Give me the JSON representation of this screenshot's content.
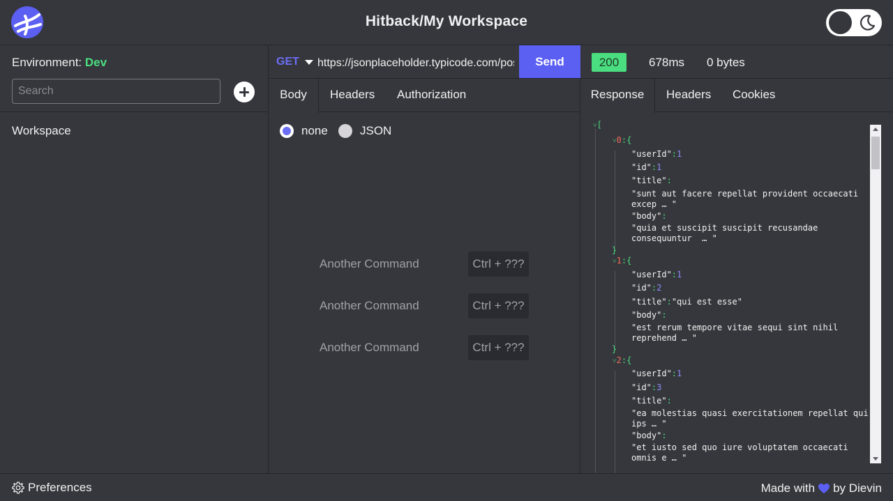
{
  "header": {
    "title": "Hitback/My Workspace",
    "logo_icon": "globe-logo",
    "theme_toggle_icon": "moon-icon"
  },
  "sidebar": {
    "environment_label": "Environment:",
    "environment_value": "Dev",
    "search_placeholder": "Search",
    "add_icon": "plus-circle-icon",
    "items": [
      {
        "label": "Workspace"
      }
    ]
  },
  "request": {
    "method": "GET",
    "url": "https://jsonplaceholder.typicode.com/posts",
    "send_label": "Send",
    "tabs": [
      {
        "label": "Body",
        "active": true
      },
      {
        "label": "Headers",
        "active": false
      },
      {
        "label": "Authorization",
        "active": false
      }
    ],
    "body_types": [
      {
        "label": "none",
        "selected": true
      },
      {
        "label": "JSON",
        "selected": false
      }
    ],
    "commands": [
      {
        "label": "Another Command",
        "shortcut": "Ctrl + ???"
      },
      {
        "label": "Another Command",
        "shortcut": "Ctrl + ???"
      },
      {
        "label": "Another Command",
        "shortcut": "Ctrl + ???"
      }
    ]
  },
  "response": {
    "status": "200",
    "time": "678ms",
    "size": "0 bytes",
    "tabs": [
      {
        "label": "Response",
        "active": true
      },
      {
        "label": "Headers",
        "active": false
      },
      {
        "label": "Cookies",
        "active": false
      }
    ],
    "json": {
      "open_bracket": "[",
      "items": [
        {
          "index": "0",
          "userId_key": "\"userId\"",
          "userId": "1",
          "id_key": "\"id\"",
          "id": "1",
          "title_key": "\"title\"",
          "title_line1": "\"sunt aut facere repellat provident occaecati",
          "title_line2": "excep … \"",
          "body_key": "\"body\"",
          "body_line1": "\"quia et suscipit suscipit recusandae",
          "body_line2": "consequuntur  … \""
        },
        {
          "index": "1",
          "userId_key": "\"userId\"",
          "userId": "1",
          "id_key": "\"id\"",
          "id": "2",
          "title_key": "\"title\"",
          "title_inline": "\"qui est esse\"",
          "body_key": "\"body\"",
          "body_line1": "\"est rerum tempore vitae sequi sint nihil",
          "body_line2": "reprehend … \""
        },
        {
          "index": "2",
          "userId_key": "\"userId\"",
          "userId": "1",
          "id_key": "\"id\"",
          "id": "3",
          "title_key": "\"title\"",
          "title_line1": "\"ea molestias quasi exercitationem repellat qui",
          "title_line2": "ips … \"",
          "body_key": "\"body\"",
          "body_line1": "\"et iusto sed quo iure voluptatem occaecati",
          "body_line2": "omnis e … \""
        }
      ]
    }
  },
  "footer": {
    "preferences_label": "Preferences",
    "made_with_prefix": "Made with",
    "made_with_suffix": "by Dievin",
    "heart_color": "#5b5ff2"
  },
  "colors": {
    "accent": "#5b5ff2",
    "env_green": "#4ade80",
    "background": "#36373c"
  }
}
